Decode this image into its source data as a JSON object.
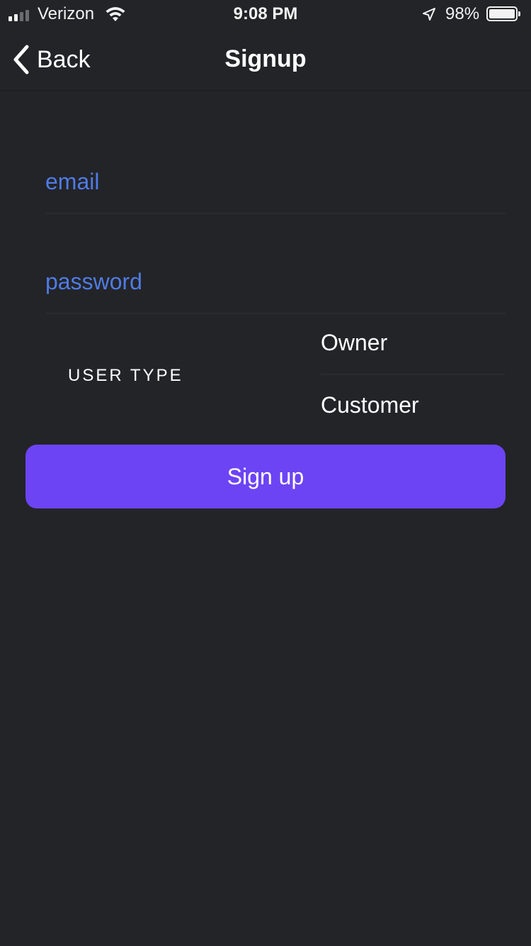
{
  "status_bar": {
    "carrier": "Verizon",
    "time": "9:08 PM",
    "battery_percent": "98%",
    "battery_level": 0.98,
    "signal_icon": "cellular-signal-icon",
    "wifi_icon": "wifi-icon",
    "location_icon": "location-arrow-icon"
  },
  "nav": {
    "back_label": "Back",
    "title": "Signup",
    "back_icon": "chevron-left-icon"
  },
  "form": {
    "email": {
      "placeholder": "email",
      "value": ""
    },
    "password": {
      "placeholder": "password",
      "value": ""
    },
    "user_type_label": "USER TYPE",
    "user_type_options": [
      "Owner",
      "Customer"
    ]
  },
  "signup_button_label": "Sign up",
  "colors": {
    "background": "#232428",
    "placeholder": "#4f7be4",
    "button": "#6c44f4",
    "text": "#ffffff"
  }
}
